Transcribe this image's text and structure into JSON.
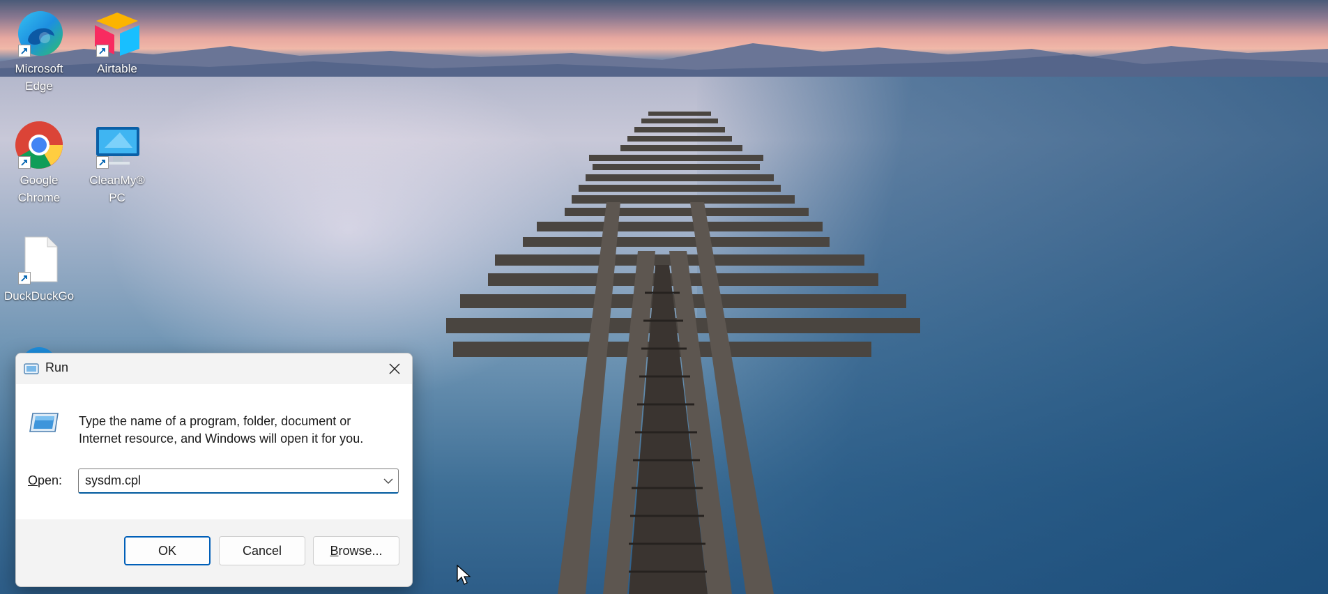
{
  "desktop": {
    "icons": [
      {
        "label": "Microsoft Edge",
        "icon": "edge-icon"
      },
      {
        "label": "Airtable",
        "icon": "airtable-icon"
      },
      {
        "label": "Google Chrome",
        "icon": "chrome-icon"
      },
      {
        "label": "CleanMy® PC",
        "icon": "cleanmypc-icon"
      },
      {
        "label": "DuckDuckGo",
        "icon": "file-icon"
      }
    ]
  },
  "run_dialog": {
    "title": "Run",
    "description": "Type the name of a program, folder, document or Internet resource, and Windows will open it for you.",
    "open_label_accel": "O",
    "open_label_rest": "pen:",
    "open_value": "sysdm.cpl",
    "buttons": {
      "ok": "OK",
      "cancel": "Cancel",
      "browse_accel": "B",
      "browse_rest": "rowse..."
    },
    "accent_color": "#005fb8"
  }
}
